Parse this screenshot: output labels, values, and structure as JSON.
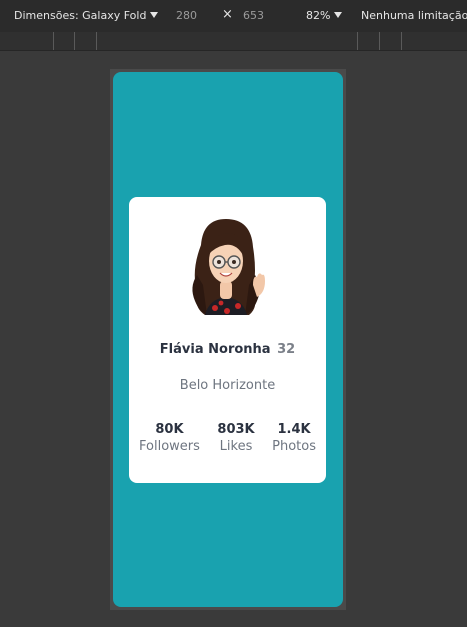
{
  "toolbar": {
    "dimensions_label": "Dimensões: Galaxy Fold",
    "width": "280",
    "times": "×",
    "height": "653",
    "zoom": "82%",
    "throttle": "Nenhuma limitação"
  },
  "profile": {
    "name": "Flávia Noronha",
    "age": "32",
    "city": "Belo Horizonte",
    "stats": [
      {
        "value": "80K",
        "label": "Followers"
      },
      {
        "value": "803K",
        "label": "Likes"
      },
      {
        "value": "1.4K",
        "label": "Photos"
      }
    ]
  },
  "colors": {
    "device_bg": "#19a2af",
    "card_bg": "#ffffff"
  },
  "icons": {
    "avatar": "cartoon-woman-avatar"
  }
}
